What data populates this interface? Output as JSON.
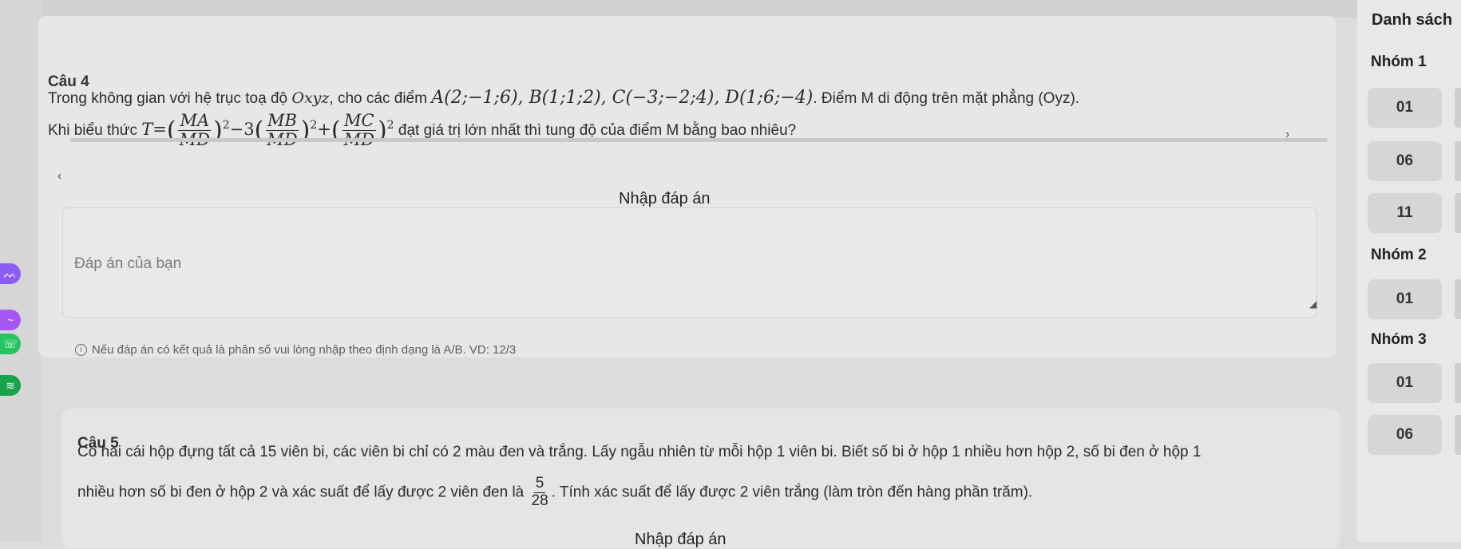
{
  "questions": [
    {
      "title": "Câu 4",
      "line1_prefix": "Trong không gian với hệ trục toạ độ ",
      "system": "Oxyz",
      "line1_mid": ", cho các điểm ",
      "points": "A(2;−1;6), B(1;1;2), C(−3;−2;4), D(1;6;−4)",
      "line1_suffix": ". Điểm M di động trên mặt phẳng (Oyz).",
      "line2_prefix": "Khi biểu thức ",
      "expr_T": "T=",
      "frac1_num": "MA",
      "frac1_den": "MD",
      "coef": "−3",
      "frac2_num": "MB",
      "frac2_den": "MD",
      "plus": "+",
      "frac3_num": "MC",
      "frac3_den": "MD",
      "exp": "2",
      "line2_suffix": " đạt giá trị lớn nhất thì tung độ của điểm M bằng bao nhiêu?",
      "answer_heading": "Nhập đáp án",
      "answer_placeholder": "Đáp án của bạn",
      "hint": "Nếu đáp án có kết quả là phân số vui lòng nhập theo định dạng là A/B. VD: 12/3"
    },
    {
      "title": "Câu 5",
      "line1": "Có hai cái hộp đựng tất cả 15 viên bi, các viên bi chỉ có 2 màu đen và trắng. Lấy ngẫu nhiên từ mỗi hộp 1 viên bi. Biết số bi ở hộp 1 nhiều hơn hộp 2, số bi đen ở hộp 1",
      "line2_prefix": "nhiều hơn số bi đen ở hộp 2 và xác suất để lấy được 2 viên đen là ",
      "frac_num": "5",
      "frac_den": "28",
      "line2_suffix": ". Tính xác suất để lấy được 2 viên trắng (làm tròn đến hàng phần trăm).",
      "answer_heading": "Nhập đáp án"
    }
  ],
  "sidebar": {
    "title": "Danh sách",
    "groups": [
      {
        "name": "Nhóm 1",
        "items": [
          "01",
          "06",
          "11"
        ]
      },
      {
        "name": "Nhóm 2",
        "items": [
          "01"
        ]
      },
      {
        "name": "Nhóm 3",
        "items": [
          "01",
          "06"
        ]
      }
    ]
  },
  "rail_icons": [
    {
      "icon": "wave-icon",
      "color": "#8b5cf6"
    },
    {
      "icon": "swirl-icon",
      "color": "#a855f7"
    },
    {
      "icon": "phone-icon",
      "color": "#22c55e"
    },
    {
      "icon": "wifi-icon",
      "color": "#16a34a"
    }
  ],
  "scroll_left": "‹",
  "scroll_right": "›",
  "resize_glyph": "◢",
  "info_glyph": "i"
}
